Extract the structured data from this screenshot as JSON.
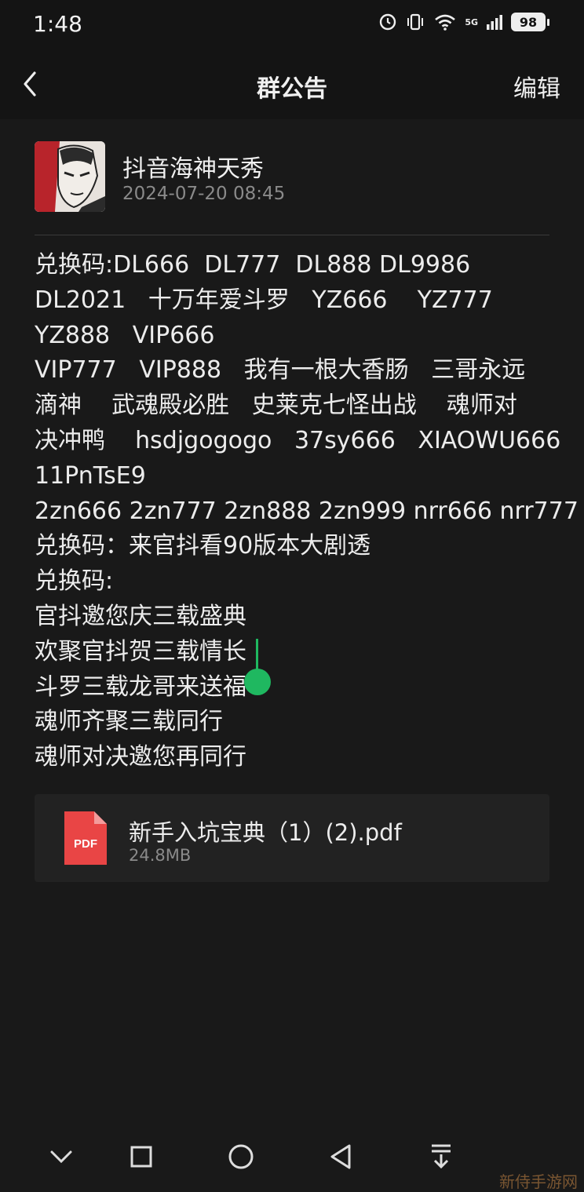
{
  "status_bar": {
    "time": "1:48",
    "battery": "98",
    "network": "5G"
  },
  "nav": {
    "title": "群公告",
    "edit_label": "编辑"
  },
  "author": {
    "name": "抖音海神天秀",
    "time": "2024-07-20 08:45"
  },
  "content_lines": [
    "兑换码:DL666  DL777  DL888 DL9986",
    "DL2021   十万年爱斗罗   YZ666    YZ777",
    "YZ888   VIP666",
    "VIP777   VIP888   我有一根大香肠   三哥永远",
    "滴神    武魂殿必胜   史莱克七怪出战    魂师对",
    "决冲鸭    hsdjgogogo   37sy666   XIAOWU666",
    "11PnTsE9",
    "2zn666 2zn777 2zn888 2zn999 nrr666 nrr777",
    "兑换码：来官抖看90版本大剧透",
    "兑换码:",
    "官抖邀您庆三载盛典",
    "欢聚官抖贺三载情长",
    "斗罗三载龙哥来送福",
    "魂师齐聚三载同行",
    "魂师对决邀您再同行"
  ],
  "attachment": {
    "icon_label": "PDF",
    "name": "新手入坑宝典（1）(2).pdf",
    "size": "24.8MB"
  },
  "watermark": "新侍手游网",
  "colors": {
    "background": "#191919",
    "accent": "#1fb860",
    "pdf_red": "#e94545"
  }
}
